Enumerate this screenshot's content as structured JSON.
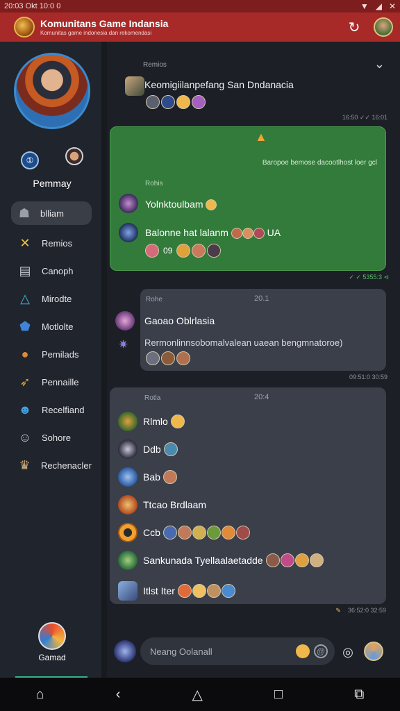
{
  "status_bar": {
    "time": "20:03 Okt 10:0 0"
  },
  "app_bar": {
    "title": "Komunitans Game Indansia",
    "subtitle": "Komunitas game indonesia dan rekomendasi",
    "refresh_icon": "refresh-icon"
  },
  "profile": {
    "name": "Pemmay"
  },
  "nav": {
    "items": [
      {
        "label": "blliam",
        "icon": "home-icon",
        "color": "#9aa0aa"
      },
      {
        "label": "Remios",
        "icon": "cross-swords-icon",
        "color": "#f2c744"
      },
      {
        "label": "Canoph",
        "icon": "store-icon",
        "color": "#c5c8cf"
      },
      {
        "label": "Mirodte",
        "icon": "triangle-icon",
        "color": "#3fb6d8"
      },
      {
        "label": "Motlolte",
        "icon": "shield-icon",
        "color": "#3f84d8"
      },
      {
        "label": "Pemilads",
        "icon": "cookie-icon",
        "color": "#d98a3a"
      },
      {
        "label": "Pennaille",
        "icon": "rocket-icon",
        "color": "#e8a02c"
      },
      {
        "label": "Recelfiand",
        "icon": "ghost-icon",
        "color": "#3f9fe0"
      },
      {
        "label": "Sohore",
        "icon": "character-icon",
        "color": "#c9cdd4"
      },
      {
        "label": "Rechenacler",
        "icon": "trophy-icon",
        "color": "#d0b07a"
      }
    ]
  },
  "bottom_game": {
    "label": "Gamad"
  },
  "chat": {
    "msg1": {
      "tag": "Remios",
      "text": "Keomigiilanpefang San Dndanacia",
      "time": "16:50 ✓✓ 16:01"
    },
    "green": {
      "note": "Baropoe bemose dacootlhost loer gcl",
      "tag": "Rohis",
      "line1": "Yolnktoulbam",
      "line2": "Balonne hat lalanm",
      "extra": "UA",
      "count": "09",
      "time": "✓ ✓ 5355:3 ⊲"
    },
    "grey1": {
      "tag": "Rohe",
      "date": "20.1",
      "title": "Gaoao Oblrlasia",
      "body": "Rermonlinnsobomalvalean uaean bengmnatoroe)",
      "time": "09:51:0 30:59"
    },
    "grey2": {
      "tag": "Rotla",
      "date": "20:4",
      "rows": [
        {
          "text": "Rlmlo"
        },
        {
          "text": "Ddb"
        },
        {
          "text": "Bab"
        },
        {
          "text": "Ttcao Brdlaam"
        },
        {
          "text": "Ccb"
        },
        {
          "text": "Sankunada Tyellaalaetadde"
        },
        {
          "text": "Itlst Iter"
        }
      ],
      "time": "36:52:0 32:59"
    }
  },
  "composer": {
    "placeholder": "Neang Oolanall"
  },
  "system_nav": {
    "gallery": "gallery-icon",
    "back": "back-icon",
    "home": "home-icon",
    "recents": "recents-icon",
    "screenshot": "screenshot-icon"
  }
}
